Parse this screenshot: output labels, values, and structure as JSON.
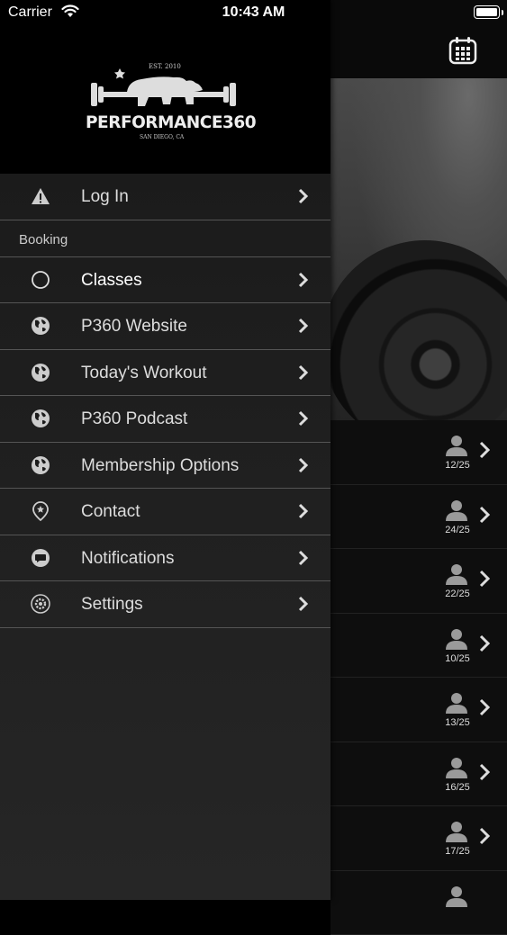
{
  "status_bar": {
    "carrier": "Carrier",
    "time": "10:43 AM"
  },
  "logo": {
    "est": "EST. 2010",
    "name": "PERFORMANCE360",
    "location": "SAN DIEGO, CA"
  },
  "menu": {
    "login_label": "Log In",
    "section_booking": "Booking",
    "items": [
      {
        "label": "Classes",
        "icon": "circle-icon"
      },
      {
        "label": "P360 Website",
        "icon": "globe-icon"
      },
      {
        "label": "Today's Workout",
        "icon": "globe-icon"
      },
      {
        "label": "P360 Podcast",
        "icon": "globe-icon"
      },
      {
        "label": "Membership Options",
        "icon": "globe-icon"
      },
      {
        "label": "Contact",
        "icon": "location-pin-icon"
      },
      {
        "label": "Notifications",
        "icon": "chat-bubble-icon"
      },
      {
        "label": "Settings",
        "icon": "gear-icon"
      }
    ]
  },
  "classes": [
    {
      "count": "12/25"
    },
    {
      "count": "24/25"
    },
    {
      "count": "22/25"
    },
    {
      "count": "10/25"
    },
    {
      "count": "13/25"
    },
    {
      "count": "16/25"
    },
    {
      "count": "17/25"
    },
    {
      "count": ""
    }
  ]
}
